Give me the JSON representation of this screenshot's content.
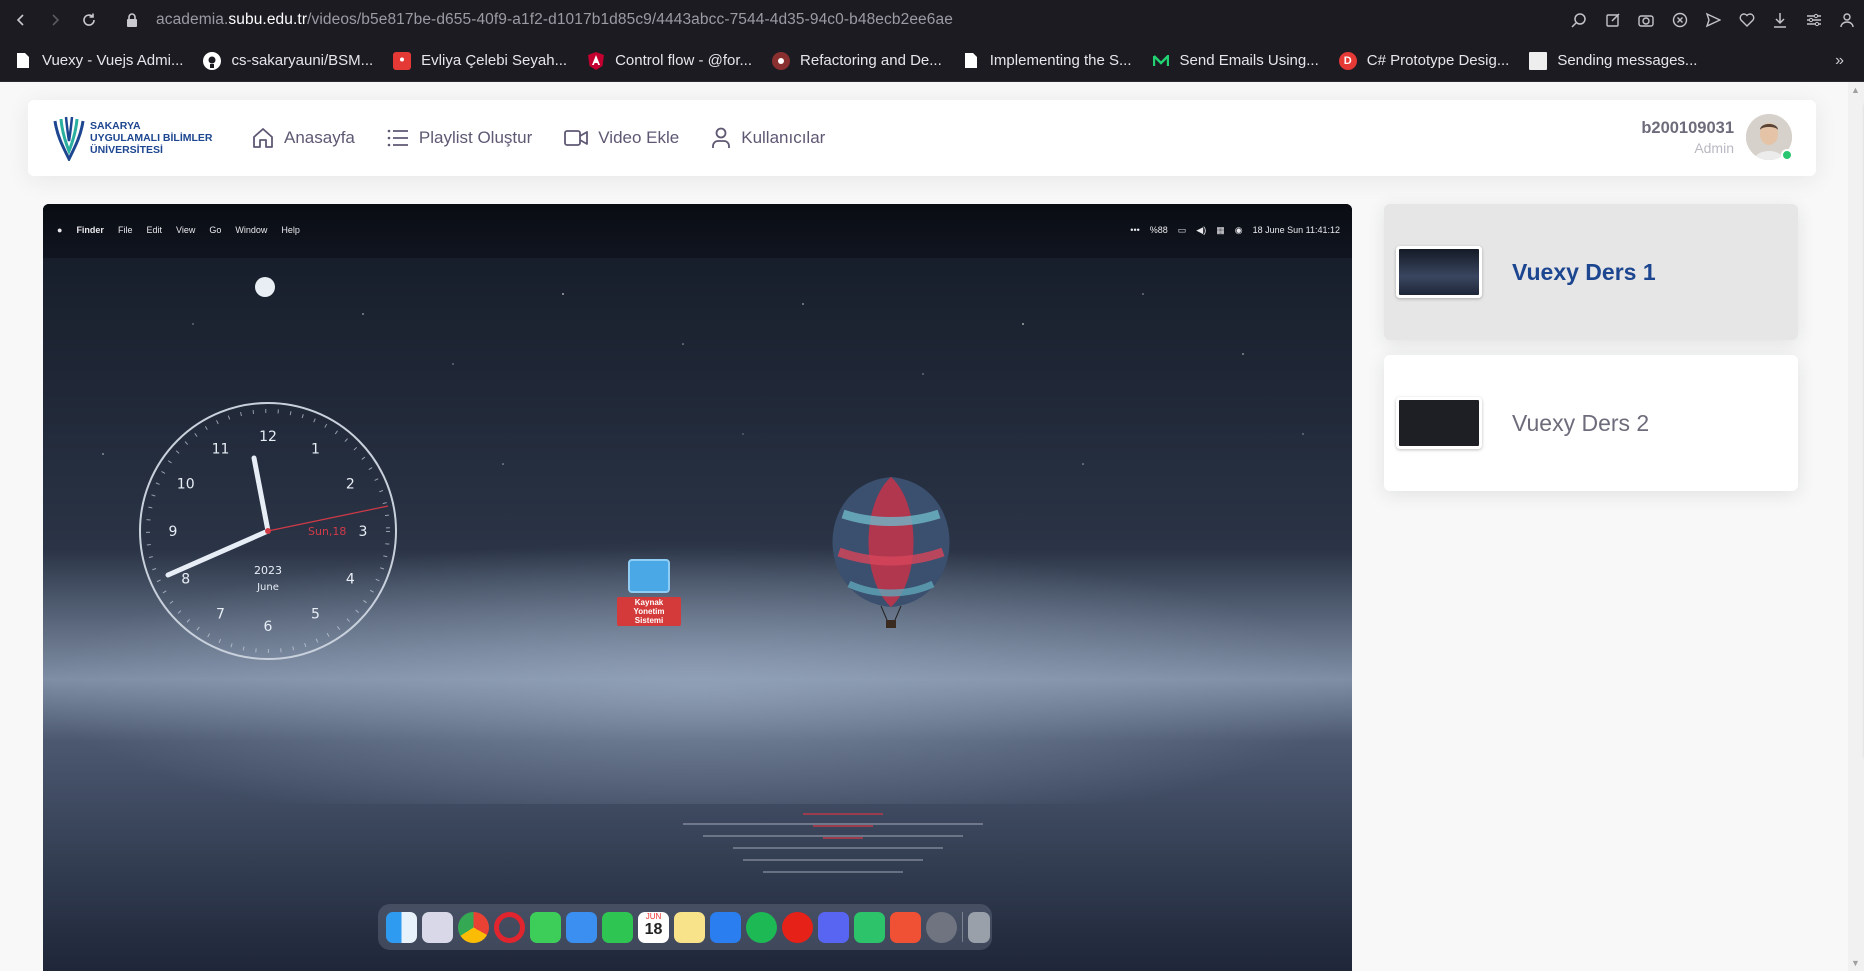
{
  "browser": {
    "url_prefix": "academia.",
    "url_host": "subu.edu.tr",
    "url_path": "/videos/b5e817be-d655-40f9-a1f2-d1017b1d85c9/4443abcc-7544-4d35-94c0-b48ecb2ee6ae"
  },
  "bookmarks": [
    {
      "label": "Vuexy - Vuejs Admi...",
      "icon": "page-icon"
    },
    {
      "label": "cs-sakaryauni/BSM...",
      "icon": "github-icon"
    },
    {
      "label": "Evliya Çelebi Seyah...",
      "icon": "map-pin-icon"
    },
    {
      "label": "Control flow - @for...",
      "icon": "angular-icon"
    },
    {
      "label": "Refactoring and De...",
      "icon": "refactoring-guru-icon"
    },
    {
      "label": "Implementing the S...",
      "icon": "page-icon"
    },
    {
      "label": "Send Emails Using...",
      "icon": "mailtrap-icon"
    },
    {
      "label": "C# Prototype Desig...",
      "icon": "d-icon"
    },
    {
      "label": "Sending messages...",
      "icon": "image-icon"
    }
  ],
  "brand": {
    "line1": "SAKARYA",
    "line2": "UYGULAMALI BİLİMLER",
    "line3": "ÜNİVERSİTESİ",
    "color": "#1d4690"
  },
  "nav": {
    "home": "Anasayfa",
    "playlist": "Playlist Oluştur",
    "video": "Video Ekle",
    "users": "Kullanıcılar"
  },
  "user": {
    "name": "b200109031",
    "role": "Admin",
    "status_color": "#28c76f"
  },
  "video": {
    "menubar": [
      "Finder",
      "File",
      "Edit",
      "View",
      "Go",
      "Window",
      "Help"
    ],
    "status": [
      "•••",
      "%88",
      "18 June Sun  11:41:12"
    ],
    "clock": {
      "numbers": [
        "12",
        "1",
        "2",
        "3",
        "4",
        "5",
        "6",
        "7",
        "8",
        "9",
        "10",
        "11"
      ],
      "day": "Sun,18",
      "year": "2023",
      "month": "June"
    },
    "folder_label_1": "Kaynak Yonetim",
    "folder_label_2": "Sistemi",
    "dock_date_month": "JUN",
    "dock_date_day": "18"
  },
  "playlist": [
    {
      "title": "Vuexy Ders 1",
      "active": true
    },
    {
      "title": "Vuexy Ders 2",
      "active": false
    }
  ]
}
